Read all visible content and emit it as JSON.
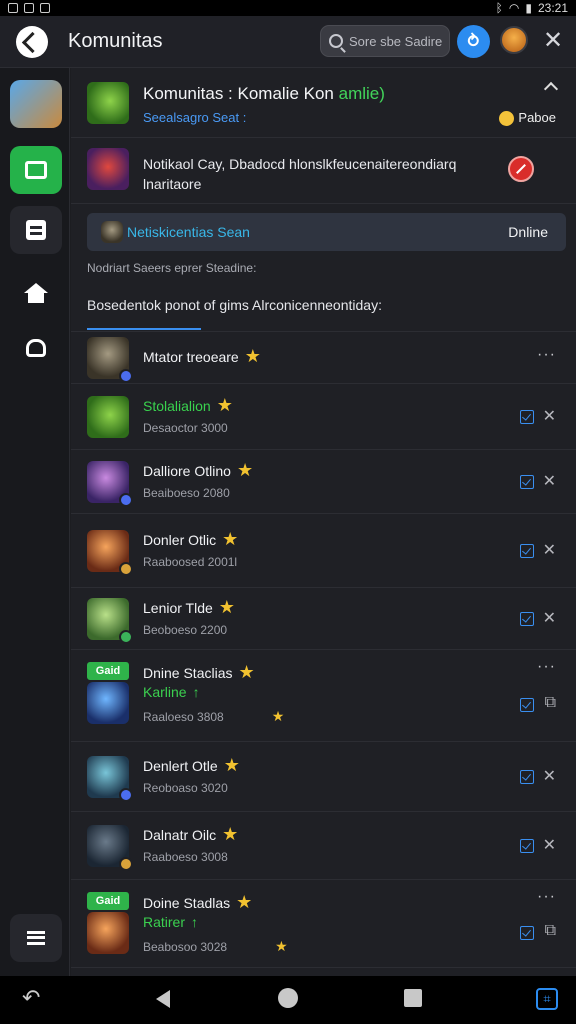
{
  "status_bar": {
    "time": "23:21"
  },
  "header": {
    "title": "Komunitas",
    "search_placeholder": "Sore sbe Sadire",
    "blue_button_glyph": "⥁",
    "close_glyph": "✕"
  },
  "sidebar": {
    "items": [
      "profile-avatar",
      "chat-icon",
      "document-icon",
      "home-icon",
      "bag-icon"
    ],
    "menu": "menu-icon"
  },
  "community": {
    "title_prefix": "Komunitas : Komalie Kon",
    "title_suffix": "amlie)",
    "subtitle": "Seealsagro Seat :",
    "reaction_label": "Paboe"
  },
  "notice": {
    "text": "Notikaol Cay, Dbadocd hlonslkfeucenaitereondiarq lnaritaore"
  },
  "online_bar": {
    "name": "Netiskicentias Sean",
    "status": "Dnline"
  },
  "hint_text": "Nodriart Saeers eprer Steadine:",
  "description": "Bosedentok ponot of gims Alrconicenneontiday:",
  "members": [
    {
      "name": "Mtator treoeare",
      "name_color": "white",
      "meta": "",
      "avatar": "gray",
      "pip": "blue",
      "actions": "dots"
    },
    {
      "name": "Stolalialion",
      "name_color": "green",
      "meta": "Desaoctor 3000",
      "avatar": "green",
      "pip": "",
      "actions": "check-x"
    },
    {
      "name": "Dalliore Otlino",
      "name_color": "white",
      "meta": "Beaiboeso 2080",
      "avatar": "purple",
      "pip": "blue",
      "actions": "check-x"
    },
    {
      "name": "Donler Otlic",
      "name_color": "white",
      "meta": "Raaboosed 2001l",
      "avatar": "orange",
      "pip": "gold",
      "actions": "check-x"
    },
    {
      "name": "Lenior Tlde",
      "name_color": "white",
      "meta": "Beoboeso 2200",
      "avatar": "lime",
      "pip": "green",
      "actions": "check-x"
    },
    {
      "name": "Dnine Staclias",
      "name_color": "white",
      "meta": "Raaloeso 3808",
      "avatar": "blue",
      "pip": "",
      "tag": "Gaid",
      "sub": "Karline",
      "actions": "dots-check"
    },
    {
      "name": "Denlert Otle",
      "name_color": "white",
      "meta": "Reoboaso 3020",
      "avatar": "teal",
      "pip": "blue",
      "actions": "check-x"
    },
    {
      "name": "Dalnatr Oilc",
      "name_color": "white",
      "meta": "Raaboeso 3008",
      "avatar": "dark",
      "pip": "gold",
      "actions": "check-x"
    },
    {
      "name": "Doine Stadlas",
      "name_color": "white",
      "meta": "Beabosoo 3028",
      "avatar": "orange",
      "pip": "",
      "tag": "Gaid",
      "sub": "Ratirer",
      "actions": "dots-check"
    }
  ]
}
